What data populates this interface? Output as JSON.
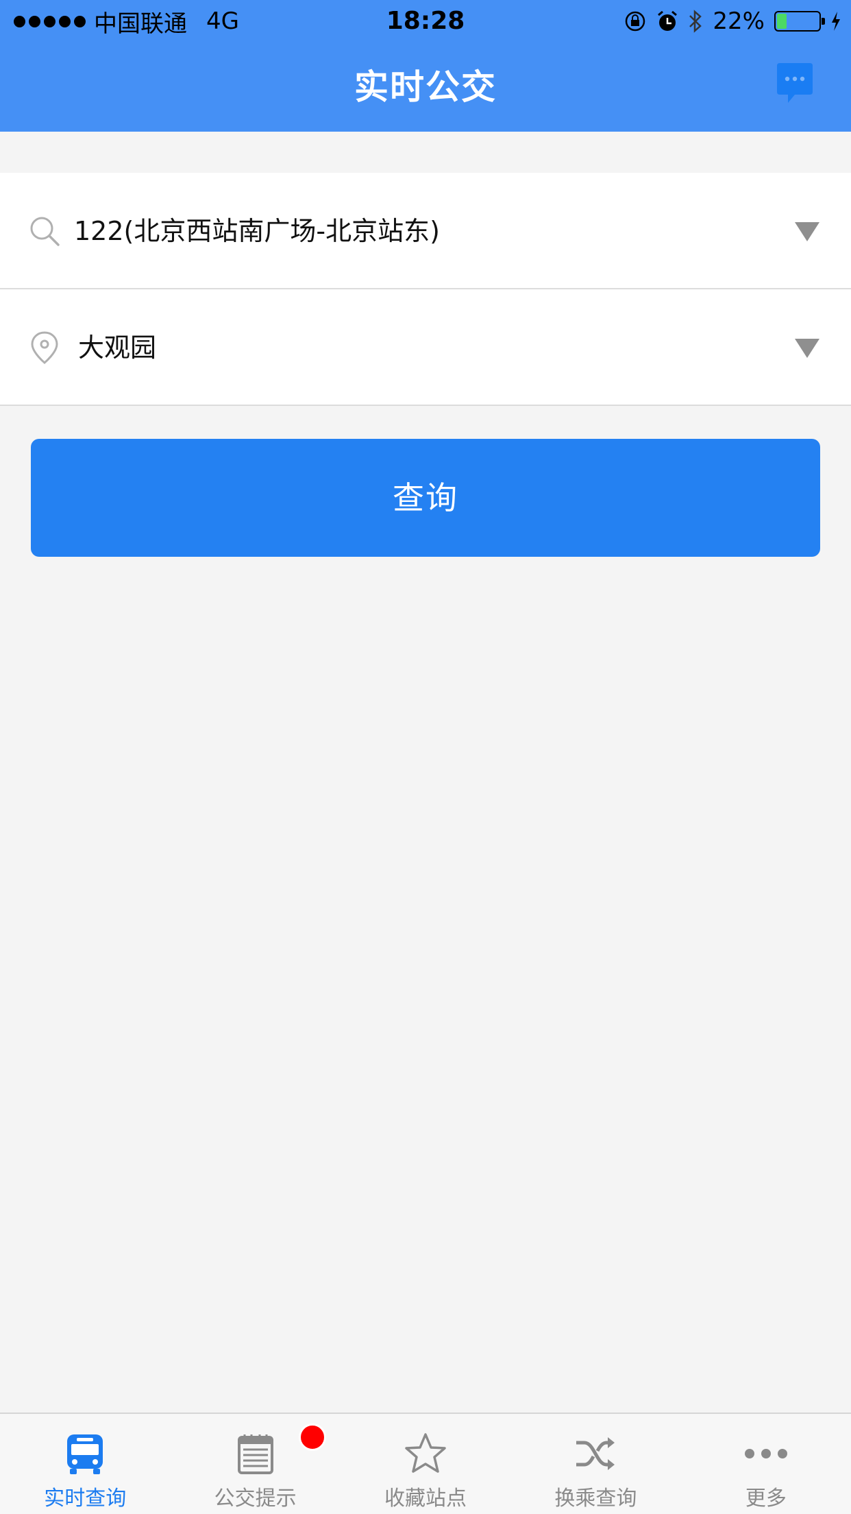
{
  "status_bar": {
    "carrier": "中国联通",
    "network": "4G",
    "time": "18:28",
    "battery": "22%",
    "battery_level": 0.22,
    "signal_dots": 5
  },
  "header": {
    "title": "实时公交",
    "message_icon": "chat-bubble-icon"
  },
  "form": {
    "line_value": "122(北京西站南广场-北京站东)",
    "station_value": "大观园",
    "search_icon": "search-icon",
    "location_icon": "location-pin-icon",
    "dropdown_icon": "triangle-down-icon"
  },
  "query_button": {
    "label": "查询"
  },
  "tabbar": {
    "tabs": [
      {
        "label": "实时查询",
        "icon": "bus-icon",
        "active": true
      },
      {
        "label": "公交提示",
        "icon": "notepad-icon",
        "badge": true
      },
      {
        "label": "收藏站点",
        "icon": "star-icon"
      },
      {
        "label": "换乘查询",
        "icon": "shuffle-icon"
      },
      {
        "label": "更多",
        "icon": "more-dots-icon"
      }
    ]
  },
  "colors": {
    "header_blue": "#4590f5",
    "button_blue": "#2481f2",
    "active_tab": "#1c7cf0",
    "badge_red": "#ff0000"
  }
}
